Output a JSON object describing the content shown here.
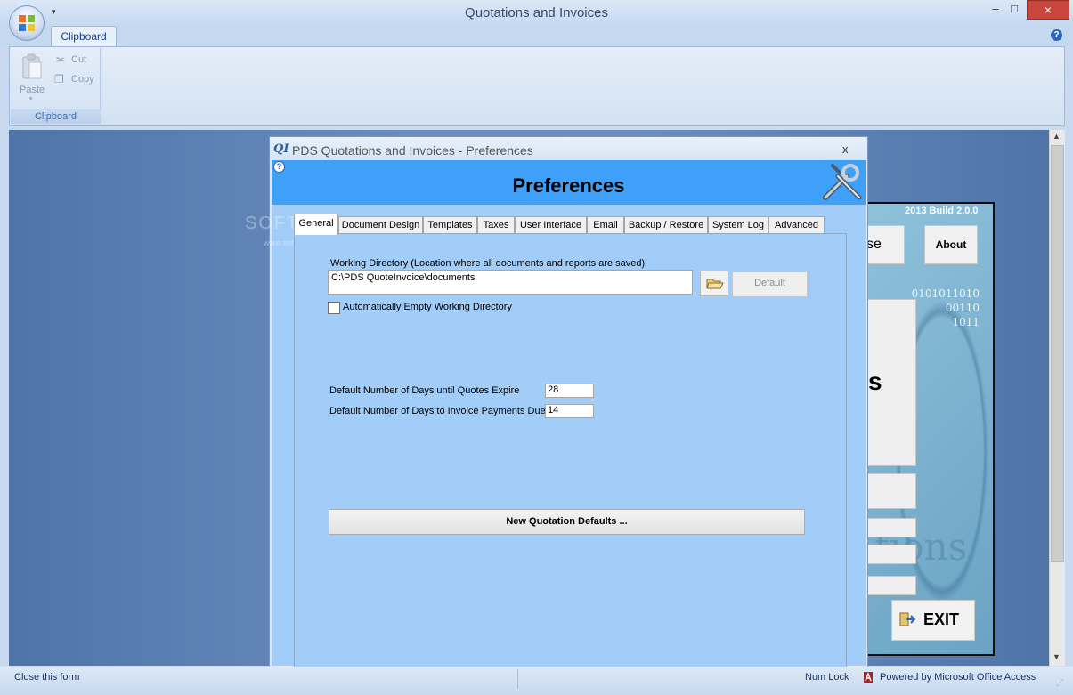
{
  "window": {
    "title": "Quotations and Invoices",
    "minimize": "–",
    "maximize": "□",
    "close": "×"
  },
  "ribbon": {
    "tabs": [
      {
        "label": "Clipboard"
      }
    ],
    "groups": [
      {
        "label": "Clipboard",
        "paste_label": "Paste",
        "cut_label": "Cut",
        "copy_label": "Copy"
      }
    ]
  },
  "background_form": {
    "build": "2013 Build 2.0.0",
    "close_partial": "se",
    "about": "About",
    "binary_lines": [
      "0101011010",
      "00110",
      "1011"
    ],
    "big_letter": "s",
    "tions": "tions",
    "exit": "EXIT"
  },
  "dialog": {
    "icon_text": "QI",
    "title": "PDS Quotations and Invoices - Preferences",
    "close": "x",
    "heading": "Preferences",
    "tabs": [
      {
        "label": "General",
        "active": true
      },
      {
        "label": "Document Design"
      },
      {
        "label": "Templates"
      },
      {
        "label": "Taxes"
      },
      {
        "label": "User Interface"
      },
      {
        "label": "Email"
      },
      {
        "label": "Backup / Restore"
      },
      {
        "label": "System Log"
      },
      {
        "label": "Advanced"
      }
    ],
    "general": {
      "working_dir_label": "Working Directory (Location where all documents and reports are saved)",
      "working_dir_value": "C:\\PDS QuoteInvoice\\documents",
      "default_button": "Default",
      "auto_empty_label": "Automatically Empty Working Directory",
      "auto_empty_checked": false,
      "quote_expire_label": "Default Number of Days until Quotes Expire",
      "quote_expire_value": "28",
      "invoice_due_label": "Default Number of Days to Invoice Payments Due",
      "invoice_due_value": "14",
      "new_quote_defaults_button": "New Quotation Defaults ..."
    }
  },
  "watermark": {
    "big": "SOFT",
    "small": "www.softpedia.com"
  },
  "statusbar": {
    "left": "Close this form",
    "numlock": "Num Lock",
    "powered": "Powered by Microsoft Office Access"
  },
  "colors": {
    "header_blue": "#3ea0f8",
    "body_blue": "#a1cdf8",
    "workspace": "#6c8fc0"
  }
}
